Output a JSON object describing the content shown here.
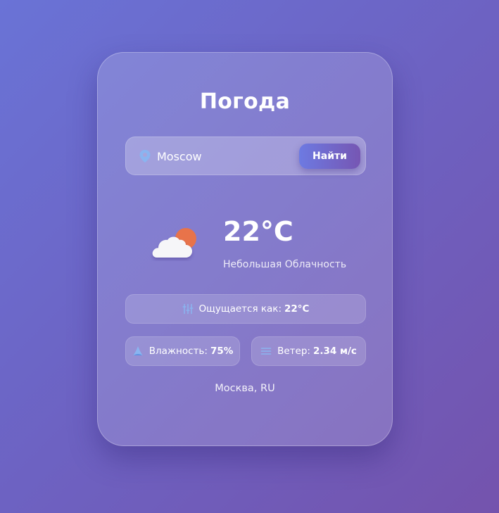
{
  "app": {
    "title": "Погода"
  },
  "search": {
    "value": "Moscow",
    "button_label": "Найти"
  },
  "weather": {
    "temperature": "22°C",
    "description": "Небольшая Облачность",
    "icon": "cloud-sun-icon"
  },
  "details": {
    "feels_like_label": "Ощущается как:",
    "feels_like_value": "22°C",
    "humidity_label": "Влажность:",
    "humidity_value": "75%",
    "wind_label": "Ветер:",
    "wind_value": "2.34 м/с"
  },
  "location": "Москва, RU",
  "colors": {
    "background_start": "#6a73d6",
    "background_end": "#7453ad",
    "accent_icon": "#8ab4f0",
    "sun": "#e8734a",
    "button_start": "#6d7ae2",
    "button_end": "#7656b3"
  }
}
